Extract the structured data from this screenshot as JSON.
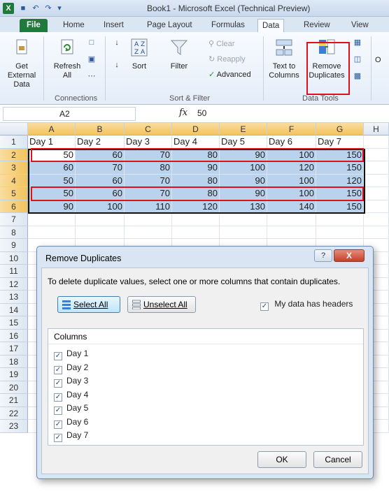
{
  "window": {
    "title": "Book1 - Microsoft Excel (Technical Preview)",
    "app_icon": "X"
  },
  "tabs": [
    "File",
    "Home",
    "Insert",
    "Page Layout",
    "Formulas",
    "Data",
    "Review",
    "View"
  ],
  "ribbon": {
    "get_external_data": "Get External Data",
    "refresh": "Refresh All",
    "connections_group": "Connections",
    "sort": "Sort",
    "filter": "Filter",
    "clear": "Clear",
    "reapply": "Reapply",
    "advanced": "Advanced",
    "sort_filter_group": "Sort & Filter",
    "text_to_columns": "Text to Columns",
    "remove_duplicates": "Remove Duplicates",
    "data_tools_group": "Data Tools",
    "overflow_char": "O"
  },
  "formula_bar": {
    "name_box": "A2",
    "fx": "fx",
    "value": "50"
  },
  "grid": {
    "columns": [
      "A",
      "B",
      "C",
      "D",
      "E",
      "F",
      "G",
      "H"
    ],
    "rows": [
      "1",
      "2",
      "3",
      "4",
      "5",
      "6",
      "7",
      "8",
      "9",
      "10",
      "11",
      "12",
      "13",
      "14",
      "15",
      "16",
      "17",
      "18",
      "19",
      "20",
      "21",
      "22",
      "23"
    ],
    "header_row": [
      "Day 1",
      "Day 2",
      "Day 3",
      "Day 4",
      "Day 5",
      "Day 6",
      "Day 7"
    ],
    "data": [
      [
        "50",
        "60",
        "70",
        "80",
        "90",
        "100",
        "150"
      ],
      [
        "60",
        "70",
        "80",
        "90",
        "100",
        "120",
        "150"
      ],
      [
        "50",
        "60",
        "70",
        "80",
        "90",
        "100",
        "120"
      ],
      [
        "50",
        "60",
        "70",
        "80",
        "90",
        "100",
        "150"
      ],
      [
        "90",
        "100",
        "110",
        "120",
        "130",
        "140",
        "150"
      ]
    ]
  },
  "dialog": {
    "title": "Remove Duplicates",
    "help": "?",
    "close": "X",
    "instructions": "To delete duplicate values, select one or more columns that contain duplicates.",
    "select_all": "Select All",
    "unselect_all": "Unselect All",
    "my_data_has_headers": "My data has headers",
    "columns_header": "Columns",
    "columns": [
      "Day 1",
      "Day 2",
      "Day 3",
      "Day 4",
      "Day 5",
      "Day 6",
      "Day 7"
    ],
    "ok": "OK",
    "cancel": "Cancel",
    "check_mark": "✓"
  }
}
